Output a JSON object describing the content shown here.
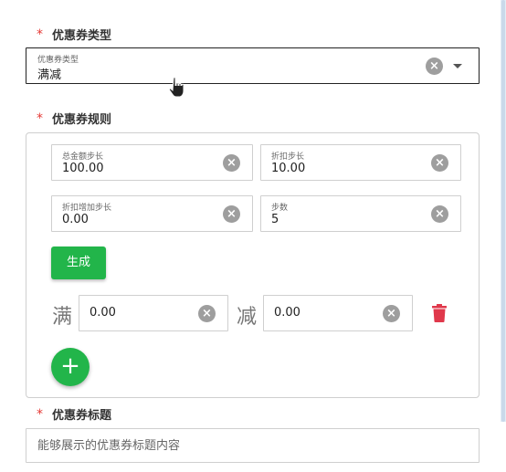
{
  "coupon_type": {
    "label": "优惠券类型",
    "required_mark": "*",
    "field_mini_label": "优惠券类型",
    "value": "满减"
  },
  "coupon_rules": {
    "label": "优惠券规则",
    "required_mark": "*",
    "fields": [
      {
        "mini_label": "总金额步长",
        "value": "100.00"
      },
      {
        "mini_label": "折扣步长",
        "value": "10.00"
      },
      {
        "mini_label": "折扣增加步长",
        "value": "0.00"
      },
      {
        "mini_label": "步数",
        "value": "5"
      }
    ],
    "generate_label": "生成",
    "rule_row": {
      "full_char": "满",
      "full_value": "0.00",
      "minus_char": "减",
      "minus_value": "0.00"
    },
    "add_label": "+"
  },
  "coupon_title": {
    "label": "优惠券标题",
    "required_mark": "*",
    "placeholder": "能够展示的优惠券标题内容"
  },
  "icons": {
    "clear": "clear-circle-icon",
    "dropdown": "caret-down-icon",
    "delete": "trash-icon",
    "cursor": "hand-pointer-cursor"
  },
  "colors": {
    "accent_green": "#22b54a",
    "required_red": "#e53935",
    "delete_red": "#e0384b",
    "clear_grey": "#9e9e9e"
  }
}
